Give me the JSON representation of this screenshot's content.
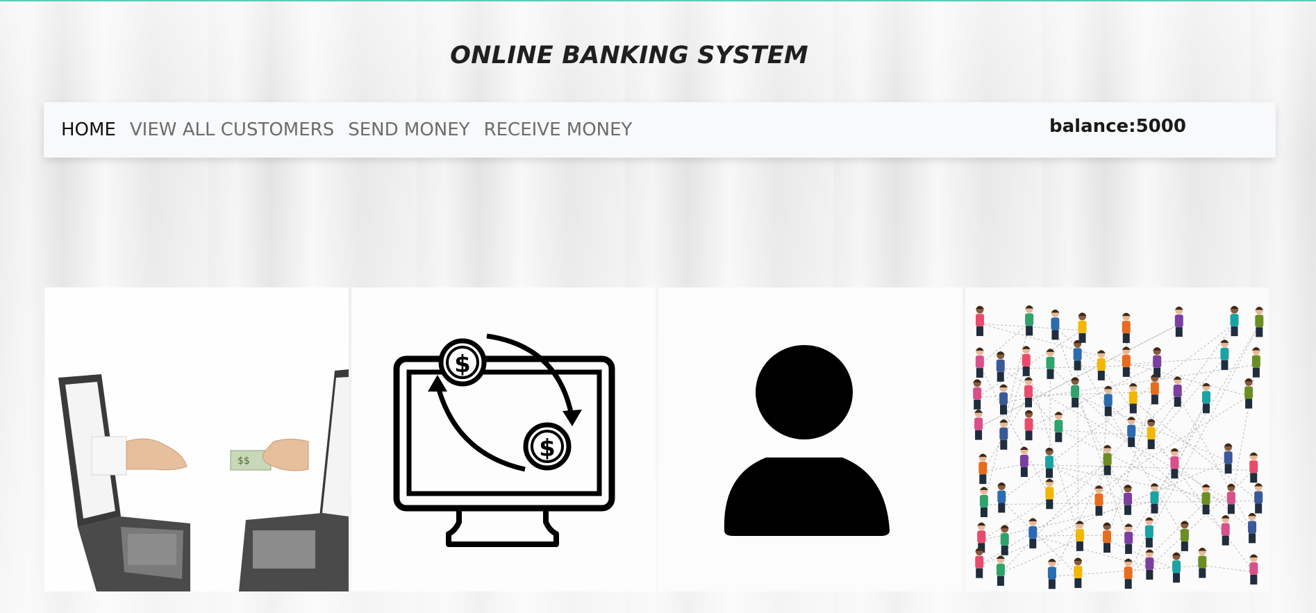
{
  "header": {
    "title": "ONLINE BANKING SYSTEM"
  },
  "nav": {
    "items": [
      {
        "label": "HOME",
        "active": true
      },
      {
        "label": "VIEW ALL CUSTOMERS",
        "active": false
      },
      {
        "label": "SEND MONEY",
        "active": false
      },
      {
        "label": "RECEIVE MONEY",
        "active": false
      }
    ],
    "balance_text": "balance:5000"
  },
  "cards": [
    {
      "name": "laptops-money-transfer-image"
    },
    {
      "name": "monitor-money-exchange-icon"
    },
    {
      "name": "user-icon"
    },
    {
      "name": "customer-network-image"
    }
  ],
  "colors": {
    "accent_line": "#5fc8b8",
    "navbar_bg": "#f8f9fa"
  }
}
